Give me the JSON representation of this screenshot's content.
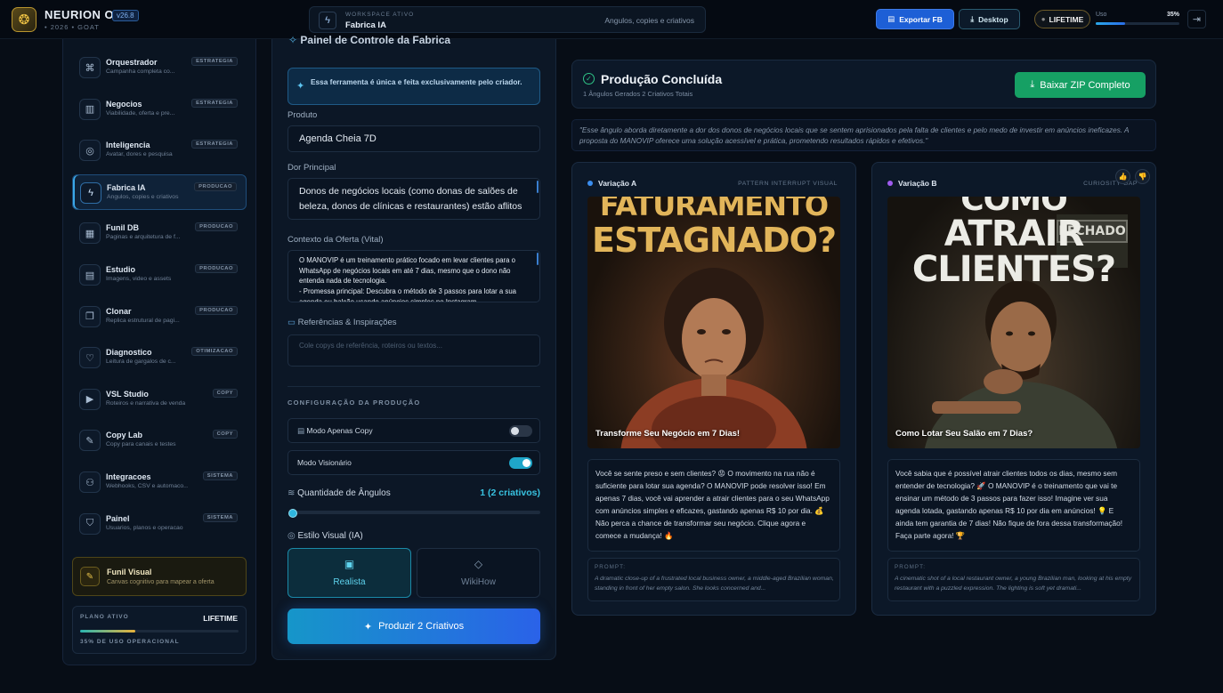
{
  "app": {
    "brand": "NEURION OS",
    "version": "v26.8",
    "subtitle": "• 2026 • GOAT"
  },
  "workspace": {
    "label": "WORKSPACE ATIVO",
    "name": "Fabrica IA",
    "description": "Angulos, copies e criativos"
  },
  "header": {
    "export_label": "Exportar FB",
    "desktop_label": "Desktop",
    "lifetime_label": "LIFETIME",
    "usage_label": "Uso",
    "usage_pct": "35%",
    "usage_value": 0.35
  },
  "sidebar": {
    "items": [
      {
        "title": "Orquestrador",
        "sub": "Campanha completa co...",
        "badge": "ESTRATEGIA",
        "icon": "command-icon"
      },
      {
        "title": "Negocios",
        "sub": "Viabilidade, oferta e pre...",
        "badge": "ESTRATEGIA",
        "icon": "briefcase-icon"
      },
      {
        "title": "Inteligencia",
        "sub": "Avatar, dores e pesquisa",
        "badge": "ESTRATEGIA",
        "icon": "target-icon"
      },
      {
        "title": "Fabrica IA",
        "sub": "Angulos, copies e criativos",
        "badge": "PRODUCAO",
        "icon": "bolt-icon",
        "active": true
      },
      {
        "title": "Funil DB",
        "sub": "Paginas e arquitetura de f...",
        "badge": "PRODUCAO",
        "icon": "layout-icon"
      },
      {
        "title": "Estudio",
        "sub": "Imagens, video e assets",
        "badge": "PRODUCAO",
        "icon": "clapper-icon"
      },
      {
        "title": "Clonar",
        "sub": "Replica estrutural de pagi...",
        "badge": "PRODUCAO",
        "icon": "copy-icon"
      },
      {
        "title": "Diagnostico",
        "sub": "Leitura de gargalos de c...",
        "badge": "OTIMIZACAO",
        "icon": "pulse-icon"
      },
      {
        "title": "VSL Studio",
        "sub": "Roteiros e narrativa de venda",
        "badge": "COPY",
        "icon": "video-icon"
      },
      {
        "title": "Copy Lab",
        "sub": "Copy para canais e testes",
        "badge": "COPY",
        "icon": "pen-icon"
      },
      {
        "title": "Integracoes",
        "sub": "Webhooks, CSV e automaco...",
        "badge": "SISTEMA",
        "icon": "plug-icon"
      },
      {
        "title": "Painel",
        "sub": "Usuarios, planos e operacao",
        "badge": "SISTEMA",
        "icon": "shield-icon"
      }
    ],
    "funnel": {
      "title": "Funil Visual",
      "sub": "Canvas cognitivo para mapear a oferta"
    },
    "plan": {
      "label": "PLANO ATIVO",
      "value": "LIFETIME",
      "footer": "35% DE USO OPERACIONAL",
      "usage": 0.35
    }
  },
  "form": {
    "title": "Painel de Controle da Fabrica",
    "info": "Essa ferramenta é única e feita exclusivamente pelo criador.",
    "product_label": "Produto",
    "product_value": "Agenda Cheia 7D",
    "pain_label": "Dor Principal",
    "pain_value": "Donos de negócios locais (como donas de salões de beleza, donos de clínicas e restaurantes) estão aflitos pela agenda vazia",
    "context_label": "Contexto da Oferta (Vital)",
    "context_value": "O MANOVIP é um treinamento prático focado em levar clientes para o WhatsApp de negócios locais em até 7 dias, mesmo que o dono não entenda nada de tecnologia.\n- Promessa principal: Descubra o método de 3 passos para lotar a sua agenda ou balcão usando anúncios simples no Instagram",
    "refs_label": "Referências & Inspirações",
    "refs_placeholder": "Cole copys de referência, roteiros ou textos...",
    "config_title": "CONFIGURAÇÃO DA PRODUÇÃO",
    "toggle_copy_label": "Modo Apenas Copy",
    "toggle_copy_on": false,
    "toggle_vision_label": "Modo Visionário",
    "toggle_vision_on": true,
    "qty_label": "Quantidade de Ângulos",
    "qty_value": "1 (2 criativos)",
    "qty_slider": 1,
    "style_label": "Estilo Visual (IA)",
    "style_options": [
      "Realista",
      "WikiHow"
    ],
    "style_selected": "Realista",
    "produce_label": "Produzir 2 Criativos"
  },
  "result": {
    "title": "Produção Concluída",
    "subtitle": "1 Ângulos Gerados 2 Criativos Totais",
    "zip_label": "Baixar ZIP Completo",
    "quote": "\"Esse ângulo aborda diretamente a dor dos donos de negócios locais que se sentem aprisionados pela falta de clientes e pelo medo de investir em anúncios ineficazes. A proposta do MANOVIP oferece uma solução acessível e prática, prometendo resultados rápidos e efetivos.\"",
    "variations": [
      {
        "name": "Variação A",
        "tag": "PATTERN INTERRUPT VISUAL",
        "color": "#3b8ef0",
        "headline": [
          "FATURAMENTO",
          "ESTAGNADO?"
        ],
        "caption": "Transforme Seu Negócio em 7 Dias!",
        "copy": "Você se sente preso e sem clientes? 😡 O movimento na rua não é suficiente para lotar sua agenda? O MANOVIP pode resolver isso! Em apenas 7 dias, você vai aprender a atrair clientes para o seu WhatsApp com anúncios simples e eficazes, gastando apenas R$ 10 por dia. 💰 Não perca a chance de transformar seu negócio. Clique agora e comece a mudança! 🔥",
        "prompt_label": "PROMPT:",
        "prompt": "A dramatic close-up of a frustrated local business owner, a middle-aged Brazilian woman, standing in front of her empty salon. She looks concerned and..."
      },
      {
        "name": "Variação B",
        "tag": "CURIOSITY GAP",
        "color": "#a05cf0",
        "headline": [
          "COMO",
          "ATRAIR",
          "CLIENTES?"
        ],
        "sign": "FECHADO",
        "caption": "Como Lotar Seu Salão em 7 Dias?",
        "copy": "Você sabia que é possível atrair clientes todos os dias, mesmo sem entender de tecnologia? 🚀 O MANOVIP é o treinamento que vai te ensinar um método de 3 passos para fazer isso! Imagine ver sua agenda lotada, gastando apenas R$ 10 por dia em anúncios! 💡 E ainda tem garantia de 7 dias! Não fique de fora dessa transformação! Faça parte agora! 🏆",
        "prompt_label": "PROMPT:",
        "prompt": "A cinematic shot of a local restaurant owner, a young Brazilian man, looking at his empty restaurant with a puzzled expression. The lighting is soft yet dramati..."
      }
    ]
  }
}
